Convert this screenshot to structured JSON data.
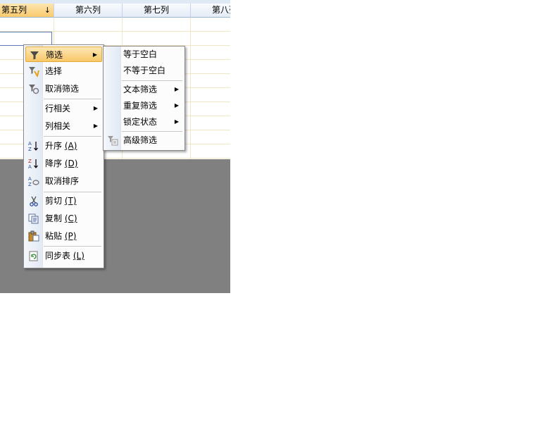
{
  "sheet": {
    "columns": [
      {
        "label": "第五列",
        "sort_indicator": "↓"
      },
      {
        "label": "第六列"
      },
      {
        "label": "第七列"
      },
      {
        "label": "第八列"
      }
    ]
  },
  "context_menu": {
    "items": [
      {
        "label": "筛选",
        "icon": "filter-icon",
        "has_submenu": true,
        "highlighted": true
      },
      {
        "label": "选择",
        "icon": "filter-select-icon"
      },
      {
        "label": "取消筛选",
        "icon": "filter-clear-icon"
      },
      {
        "label": "行相关",
        "has_submenu": true
      },
      {
        "label": "列相关",
        "has_submenu": true
      },
      {
        "label": "升序",
        "accel": "(A)",
        "icon": "sort-ascending-icon"
      },
      {
        "label": "降序",
        "accel": "(D)",
        "icon": "sort-descending-icon"
      },
      {
        "label": "取消排序",
        "icon": "sort-clear-icon"
      },
      {
        "label": "剪切",
        "accel": "(T)",
        "icon": "cut-icon"
      },
      {
        "label": "复制",
        "accel": "(C)",
        "icon": "copy-icon"
      },
      {
        "label": "粘贴",
        "accel": "(P)",
        "icon": "paste-icon"
      },
      {
        "label": "同步表",
        "accel": "(L)",
        "icon": "sync-table-icon"
      }
    ]
  },
  "filter_submenu": {
    "items": [
      {
        "label": "等于空白"
      },
      {
        "label": "不等于空白"
      },
      {
        "label": "文本筛选",
        "has_submenu": true
      },
      {
        "label": "重复筛选",
        "has_submenu": true
      },
      {
        "label": "锁定状态",
        "has_submenu": true
      },
      {
        "label": "高级筛选",
        "icon": "advanced-filter-icon"
      }
    ]
  },
  "colors": {
    "highlight": "#f8c868",
    "gray_area": "#808080",
    "header": "#e4ecf7"
  }
}
